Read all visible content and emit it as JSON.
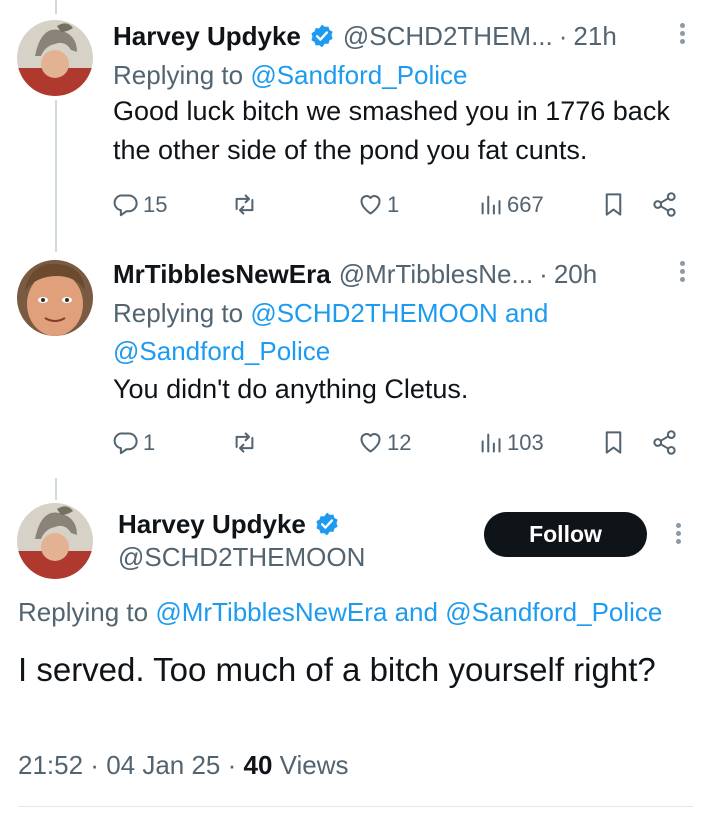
{
  "replies": [
    {
      "display_name": "Harvey Updyke",
      "verified": true,
      "handle": "@SCHD2THEM...",
      "time": "21h",
      "replying_prefix": "Replying to ",
      "replying_to": [
        "@Sandford_Police"
      ],
      "replying_joiner": "",
      "text": "Good luck bitch we smashed you in 1776 back the other side of the pond you fat cunts.",
      "replies_count": "15",
      "retweets_count": "",
      "likes_count": "1",
      "views_count": "667"
    },
    {
      "display_name": "MrTibblesNewEra",
      "verified": false,
      "handle": "@MrTibblesNe...",
      "time": "20h",
      "replying_prefix": "Replying to ",
      "replying_to": [
        "@SCHD2THEMOON",
        "@Sandford_Police"
      ],
      "replying_joiner": " and",
      "text": "You didn't do anything Cletus.",
      "replies_count": "1",
      "retweets_count": "",
      "likes_count": "12",
      "views_count": "103"
    }
  ],
  "main_tweet": {
    "display_name": "Harvey Updyke",
    "verified": true,
    "handle": "@SCHD2THEMOON",
    "follow_label": "Follow",
    "replying_prefix": "Replying to ",
    "replying_to_1": "@MrTibblesNewEra",
    "replying_joiner": " and ",
    "replying_to_2": "@Sandford_Police",
    "text": "I served. Too much of a bitch yourself right?",
    "time": "21:52",
    "date": "04 Jan 25",
    "views_count": "40",
    "views_label": " Views"
  },
  "separator": " · ",
  "colors": {
    "link": "#1d9bf0",
    "verified": "#1d9bf0",
    "secondary_text": "#536471",
    "follow_bg": "#0f1419"
  }
}
